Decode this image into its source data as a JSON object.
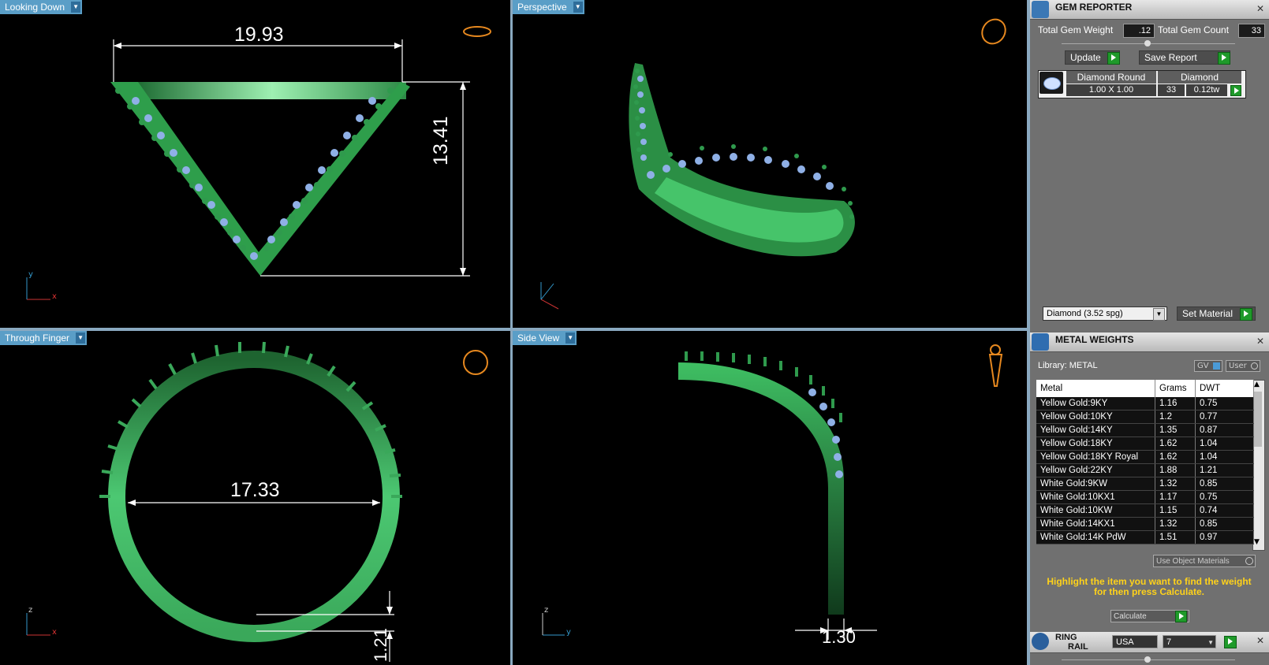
{
  "viewports": {
    "top_left": {
      "tab": "Looking Down",
      "dim_width": "19.93",
      "dim_height": "13.41"
    },
    "top_right": {
      "tab": "Perspective"
    },
    "bottom_left": {
      "tab": "Through Finger",
      "dim_inner": "17.33",
      "dim_thickness": "1.21"
    },
    "bottom_right": {
      "tab": "Side View",
      "dim_width": "1.30"
    }
  },
  "axes": {
    "x": "x",
    "y": "y",
    "z": "z"
  },
  "gem_reporter": {
    "title": "GEM REPORTER",
    "total_weight_label": "Total Gem Weight",
    "total_weight_value": ".12",
    "total_count_label": "Total Gem Count",
    "total_count_value": "33",
    "update_label": "Update",
    "save_report_label": "Save Report",
    "gem_row": {
      "name": "Diamond Round",
      "type": "Diamond",
      "size": "1.00 X 1.00",
      "count": "33",
      "weight": "0.12tw"
    },
    "material_select": "Diamond     (3.52 spg)",
    "set_material_label": "Set Material"
  },
  "metal_weights": {
    "title": "METAL WEIGHTS",
    "library_label": "Library: METAL",
    "gv_label": "GV",
    "user_label": "User",
    "columns": [
      "Metal",
      "Grams",
      "DWT"
    ],
    "rows": [
      [
        "Yellow Gold:9KY",
        "1.16",
        "0.75"
      ],
      [
        "Yellow Gold:10KY",
        "1.2",
        "0.77"
      ],
      [
        "Yellow Gold:14KY",
        "1.35",
        "0.87"
      ],
      [
        "Yellow Gold:18KY",
        "1.62",
        "1.04"
      ],
      [
        "Yellow Gold:18KY Royal",
        "1.62",
        "1.04"
      ],
      [
        "Yellow Gold:22KY",
        "1.88",
        "1.21"
      ],
      [
        "White Gold:9KW",
        "1.32",
        "0.85"
      ],
      [
        "White Gold:10KX1",
        "1.17",
        "0.75"
      ],
      [
        "White Gold:10KW",
        "1.15",
        "0.74"
      ],
      [
        "White Gold:14KX1",
        "1.32",
        "0.85"
      ],
      [
        "White Gold:14K PdW",
        "1.51",
        "0.97"
      ]
    ],
    "use_object_materials": "Use Object Materials",
    "hint": "Highlight the item you want to find the weight for then press Calculate.",
    "calculate_label": "Calculate"
  },
  "ring_rail": {
    "title_line1": "RING",
    "title_line2": "RAIL",
    "country": "USA",
    "size": "7"
  },
  "colors": {
    "ring_green": "#3fbf63",
    "gem_blue": "#8fb0e6",
    "accent_tab": "#5a9ec7",
    "hint_yellow": "#ffd21a"
  }
}
